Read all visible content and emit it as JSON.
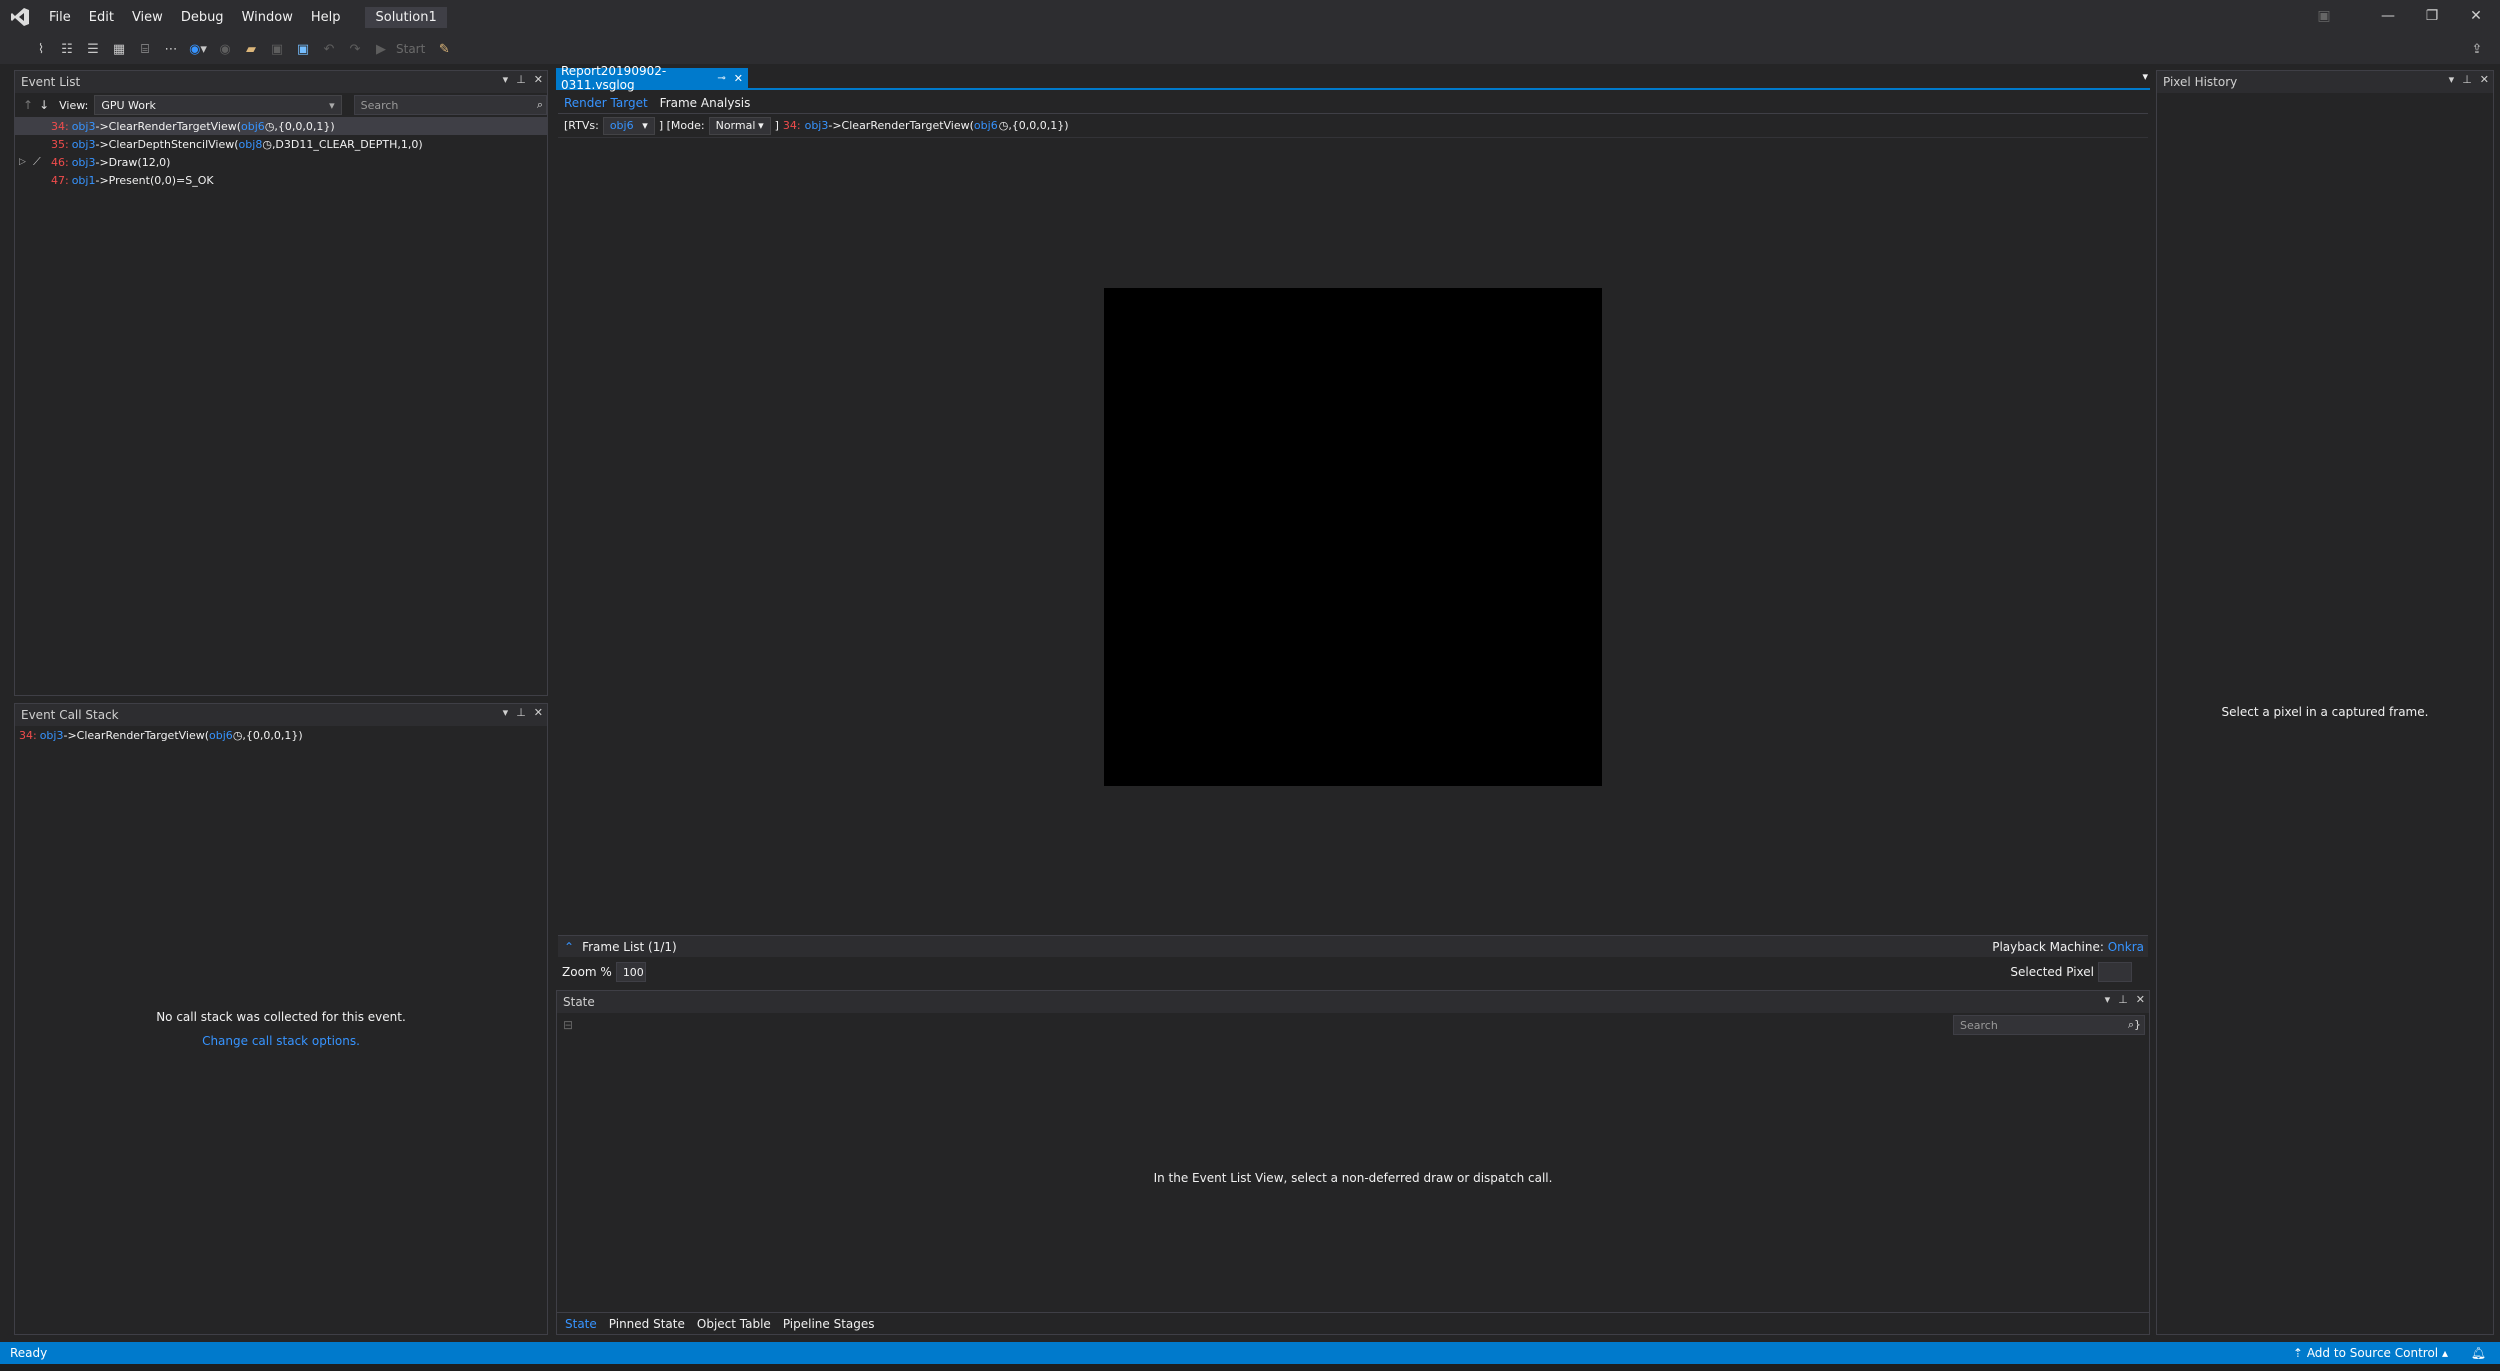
{
  "menu": {
    "items": [
      "File",
      "Edit",
      "View",
      "Debug",
      "Window",
      "Help"
    ],
    "solution": "Solution1"
  },
  "toolbar": {
    "start_label": "Start"
  },
  "event_list": {
    "title": "Event List",
    "view_label": "View:",
    "view_value": "GPU Work",
    "search_placeholder": "Search",
    "events": [
      {
        "num": "34:",
        "obj": "obj3",
        "call": "->ClearRenderTargetView(",
        "arg_obj": "obj6",
        "rest": ",{0,0,0,1})",
        "selected": true,
        "expandable": false,
        "clock": true
      },
      {
        "num": "35:",
        "obj": "obj3",
        "call": "->ClearDepthStencilView(",
        "arg_obj": "obj8",
        "rest": ",D3D11_CLEAR_DEPTH,1,0)",
        "selected": false,
        "expandable": false,
        "clock": true
      },
      {
        "num": "46:",
        "obj": "obj3",
        "call": "->Draw(12,0)",
        "arg_obj": "",
        "rest": "",
        "selected": false,
        "expandable": true,
        "clock": false
      },
      {
        "num": "47:",
        "obj": "obj1",
        "call": "->Present(0,0)=S_OK",
        "arg_obj": "",
        "rest": "",
        "selected": false,
        "expandable": false,
        "clock": false
      }
    ]
  },
  "call_stack": {
    "title": "Event Call Stack",
    "entry": {
      "num": "34:",
      "obj": "obj3",
      "call": "->ClearRenderTargetView(",
      "arg_obj": "obj6",
      "rest": ",{0,0,0,1})"
    },
    "empty_message": "No call stack was collected for this event.",
    "options_link": "Change call stack options."
  },
  "document": {
    "tab_label": "Report20190902-0311.vsglog",
    "sub_tabs": [
      "Render Target",
      "Frame Analysis"
    ],
    "rtv_prefix": "[RTVs:",
    "rtv_value": "obj6",
    "mode_prefix": "] [Mode:",
    "mode_value": "Normal",
    "mode_suffix": "]",
    "event_num": "34:",
    "event_obj": "obj3",
    "event_call": "->ClearRenderTargetView(",
    "event_arg": "obj6",
    "event_rest": ",{0,0,0,1})",
    "frame_list": "Frame List (1/1)",
    "playback_label": "Playback Machine:",
    "playback_value": "Onkra",
    "zoom_label": "Zoom %",
    "zoom_value": "100",
    "selected_pixel_label": "Selected Pixel"
  },
  "state_panel": {
    "title": "State",
    "search_placeholder": "Search",
    "message": "In the Event List View, select a non-deferred draw or dispatch call.",
    "tabs": [
      "State",
      "Pinned State",
      "Object Table",
      "Pipeline Stages"
    ]
  },
  "pixel_history": {
    "title": "Pixel History",
    "message": "Select a pixel in a captured frame."
  },
  "status": {
    "left": "Ready",
    "source_control": "Add to Source Control"
  },
  "colors": {
    "accent": "#007acc",
    "link": "#3794ff",
    "event_number": "#f14c4c"
  }
}
